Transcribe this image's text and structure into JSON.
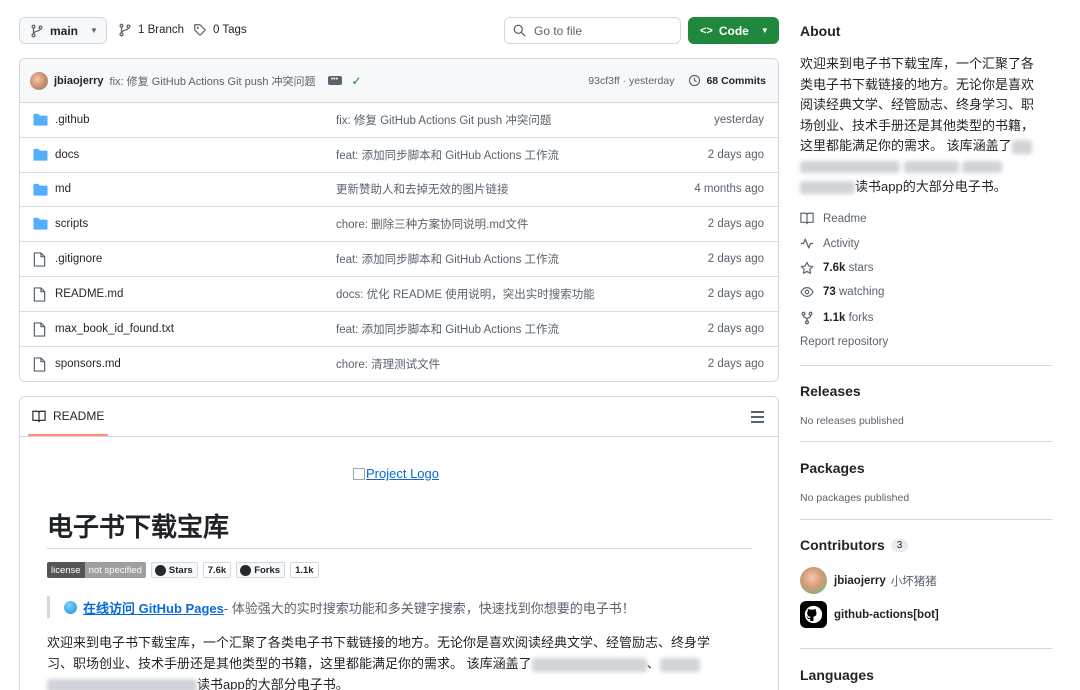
{
  "toolbar": {
    "branch_button": "main",
    "branches": "1 Branch",
    "tags": "0 Tags",
    "search_placeholder": "Go to file",
    "code_button": "Code"
  },
  "commit": {
    "author": "jbiaojerry",
    "message": "fix: 修复 GitHub Actions Git push 冲突问题",
    "sha_time": "93cf3ff · yesterday",
    "commits_count": "68 Commits"
  },
  "files": [
    {
      "name": ".github",
      "type": "folder",
      "message": "fix: 修复 GitHub Actions Git push 冲突问题",
      "date": "yesterday"
    },
    {
      "name": "docs",
      "type": "folder",
      "message": "feat: 添加同步脚本和 GitHub Actions 工作流",
      "date": "2 days ago"
    },
    {
      "name": "md",
      "type": "folder",
      "message": "更新赞助人和去掉无效的图片链接",
      "date": "4 months ago"
    },
    {
      "name": "scripts",
      "type": "folder",
      "message": "chore: 删除三种方案协同说明.md文件",
      "date": "2 days ago"
    },
    {
      "name": ".gitignore",
      "type": "file",
      "message": "feat: 添加同步脚本和 GitHub Actions 工作流",
      "date": "2 days ago"
    },
    {
      "name": "README.md",
      "type": "file",
      "message": "docs: 优化 README 使用说明，突出实时搜索功能",
      "date": "2 days ago"
    },
    {
      "name": "max_book_id_found.txt",
      "type": "file",
      "message": "feat: 添加同步脚本和 GitHub Actions 工作流",
      "date": "2 days ago"
    },
    {
      "name": "sponsors.md",
      "type": "file",
      "message": "chore: 清理测试文件",
      "date": "2 days ago"
    }
  ],
  "readme": {
    "tab_label": "README",
    "logo_alt": "Project Logo",
    "title": "电子书下载宝库",
    "badges": {
      "license_label": "license",
      "license_value": "not specified",
      "stars_label": "Stars",
      "stars_value": "7.6k",
      "forks_label": "Forks",
      "forks_value": "1.1k"
    },
    "quote_link": "在线访问 GitHub Pages",
    "quote_text": " - 体验强大的实时搜索功能和多关键字搜索，快速找到你想要的电子书！",
    "para_line1": "欢迎来到电子书下载宝库，一个汇聚了各类电子书下载链接的地方。无论你是喜欢阅读经典文学、经管励志、终身学",
    "para_line2a": "习、职场创业、技术手册还是其他类型的书籍，这里都能满足你的需求。 该库涵盖了",
    "para_line2b": "、",
    "para_line3": "读书app的大部分电子书。"
  },
  "about": {
    "heading": "About",
    "description_lines": [
      "欢迎来到电子书下载宝库，一个汇聚了各",
      "类电子书下载链接的地方。无论你是喜欢",
      "阅读经典文学、经管励志、终身学习、职",
      "场创业、技术手册还是其他类型的书籍，",
      "这里都能满足你的需求。 该库涵盖了"
    ],
    "description_tail": "读书app的大部分电子书。",
    "readme": "Readme",
    "activity": "Activity",
    "stars_count": "7.6k",
    "stars_label": "stars",
    "watching_count": "73",
    "watching_label": "watching",
    "forks_count": "1.1k",
    "forks_label": "forks",
    "report": "Report repository"
  },
  "releases": {
    "heading": "Releases",
    "empty": "No releases published"
  },
  "packages": {
    "heading": "Packages",
    "empty": "No packages published"
  },
  "contributors": {
    "heading": "Contributors",
    "count": "3",
    "people": [
      {
        "login": "jbiaojerry",
        "name": "小坏猪猪"
      },
      {
        "login": "github-actions[bot]",
        "name": ""
      }
    ]
  },
  "languages": {
    "heading": "Languages"
  },
  "colors": {
    "accent_green": "#1f883d",
    "link_blue": "#0969da",
    "folder_blue": "#54aeff",
    "tab_underline": "#fd8c73"
  }
}
